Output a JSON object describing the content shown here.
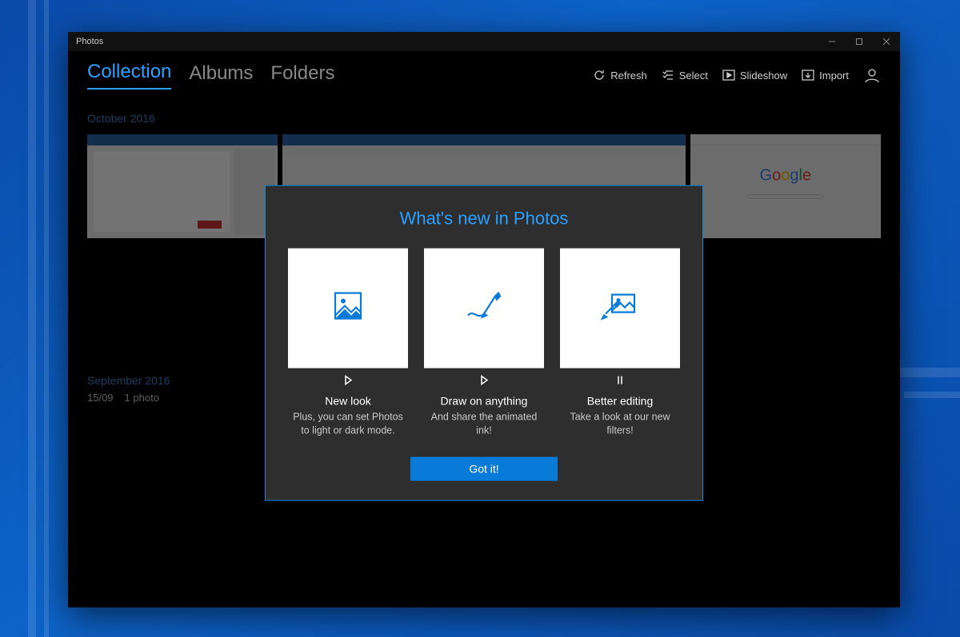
{
  "window": {
    "title": "Photos"
  },
  "tabs": {
    "collection": "Collection",
    "albums": "Albums",
    "folders": "Folders"
  },
  "actions": {
    "refresh": "Refresh",
    "select": "Select",
    "slideshow": "Slideshow",
    "import": "Import"
  },
  "groups": {
    "g1": {
      "heading": "October 2016"
    },
    "g2": {
      "heading": "September 2016",
      "date": "15/09",
      "count": "1 photo"
    }
  },
  "dialog": {
    "title": "What's new in Photos",
    "cards": [
      {
        "title": "New look",
        "desc": "Plus, you can set Photos to light or dark mode."
      },
      {
        "title": "Draw on anything",
        "desc": "And share the animated ink!"
      },
      {
        "title": "Better editing",
        "desc": "Take a look at our new filters!"
      }
    ],
    "button": "Got it!"
  }
}
